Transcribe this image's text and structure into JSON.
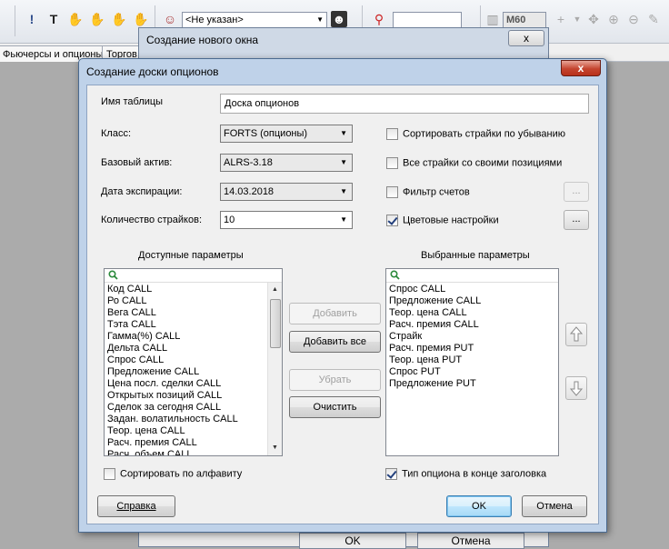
{
  "toolbar": {
    "user_select": "<Не указан>",
    "period_select": "M60"
  },
  "bg_tabs": [
    "Фьючерсы и опционы",
    "Торгов"
  ],
  "new_window": {
    "title": "Создание нового окна",
    "close": "x",
    "ok": "OK",
    "cancel": "Отмена"
  },
  "dialog": {
    "title": "Создание доски опционов",
    "close": "x",
    "table_name_label": "Имя таблицы",
    "table_name_value": "Доска опционов",
    "class_label": "Класс:",
    "class_value": "FORTS (опционы)",
    "base_asset_label": "Базовый актив:",
    "base_asset_value": "ALRS-3.18",
    "expiry_label": "Дата экспирации:",
    "expiry_value": "14.03.2018",
    "strikes_label": "Количество страйков:",
    "strikes_value": "10",
    "options": {
      "sort_desc": "Сортировать страйки по убыванию",
      "all_strikes": "Все страйки со своими позициями",
      "account_filter": "Фильтр счетов",
      "color_settings": "Цветовые настройки"
    },
    "ellipsis": "...",
    "available_header": "Доступные параметры",
    "selected_header": "Выбранные параметры",
    "available_items": [
      "Код CALL",
      "Ро CALL",
      "Вега CALL",
      "Тэта CALL",
      "Гамма(%) CALL",
      "Дельта CALL",
      "Спрос CALL",
      "Предложение CALL",
      "Цена посл. сделки CALL",
      "Открытых позиций CALL",
      "Сделок за сегодня CALL",
      "Задан. волатильность CALL",
      "Теор. цена CALL",
      "Расч. премия CALL",
      "Расч. объем CALL"
    ],
    "selected_items": [
      "Спрос CALL",
      "Предложение CALL",
      "Теор. цена CALL",
      "Расч. премия CALL",
      "Страйк",
      "Расч. премия PUT",
      "Теор. цена PUT",
      "Спрос PUT",
      "Предложение PUT"
    ],
    "btn_add": "Добавить",
    "btn_add_all": "Добавить все",
    "btn_remove": "Убрать",
    "btn_clear": "Очистить",
    "sort_alpha": "Сортировать по алфавиту",
    "option_type_end": "Тип опциона в конце заголовка",
    "btn_help": "Справка",
    "btn_ok": "OK",
    "btn_cancel": "Отмена"
  }
}
